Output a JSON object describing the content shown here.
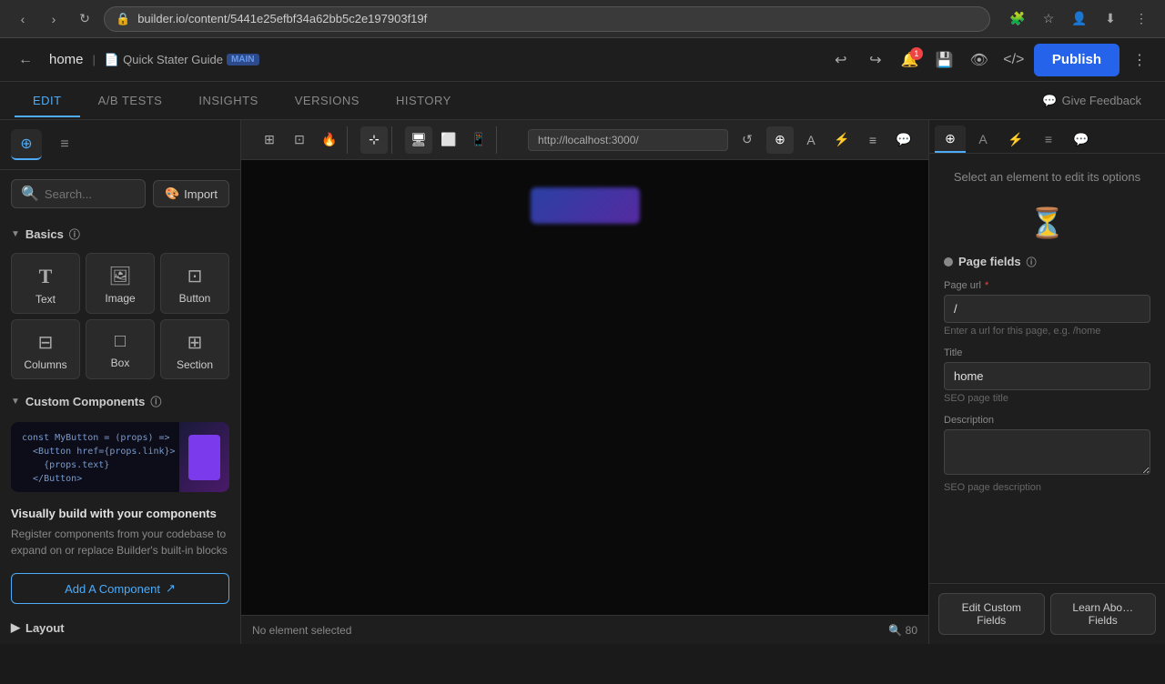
{
  "browser": {
    "url": "builder.io/content/5441e25efbf34a62bb5c2e197903f19f",
    "back_title": "back",
    "forward_title": "forward",
    "refresh_title": "refresh"
  },
  "app_header": {
    "back_label": "←",
    "page_name": "home",
    "breadcrumb_label": "Quick Stater Guide",
    "badge_label": "MAIN",
    "undo_label": "↩",
    "redo_label": "↪",
    "preview_label": "👁",
    "code_label": "</>",
    "bell_label": "🔔",
    "notification_count": "1",
    "publish_label": "Publish",
    "more_label": "⋮"
  },
  "tabs": {
    "items": [
      {
        "id": "edit",
        "label": "EDIT",
        "active": true
      },
      {
        "id": "ab_tests",
        "label": "A/B TESTS",
        "active": false
      },
      {
        "id": "insights",
        "label": "INSIGHTS",
        "active": false
      },
      {
        "id": "versions",
        "label": "VERSIONS",
        "active": false
      },
      {
        "id": "history",
        "label": "HISTORY",
        "active": false
      }
    ],
    "feedback_label": "Give Feedback"
  },
  "toolbar": {
    "layout_btn": "⊞",
    "grid_btn": "⊡",
    "fire_btn": "🔥",
    "select_btn": "⊹",
    "desktop_btn": "🖥",
    "tablet_btn": "⬜",
    "mobile_btn": "📱",
    "url_value": "http://localhost:3000/",
    "refresh_label": "↺",
    "target_btn": "⊕",
    "paint_btn": "🎨",
    "bolt_btn": "⚡",
    "columns_btn": "≡",
    "chat_btn": "💬"
  },
  "left_sidebar": {
    "tab_add": "+",
    "tab_layers": "≡",
    "search_placeholder": "Search...",
    "import_label": "Import",
    "import_icon": "🎨",
    "sections": {
      "basics": {
        "label": "Basics",
        "components": [
          {
            "id": "text",
            "label": "Text",
            "icon": "T"
          },
          {
            "id": "image",
            "label": "Image",
            "icon": "🖼"
          },
          {
            "id": "button",
            "label": "Button",
            "icon": "⊡"
          },
          {
            "id": "columns",
            "label": "Columns",
            "icon": "⊟"
          },
          {
            "id": "box",
            "label": "Box",
            "icon": "□"
          },
          {
            "id": "section",
            "label": "Section",
            "icon": "⊞"
          }
        ]
      },
      "custom": {
        "label": "Custom Components",
        "code_snippet": "const MyButton = (props) =>\n  <Button href={props.link}>\n    {props.text}\n  </Button>",
        "title": "Visually build with your components",
        "description": "Register components from your codebase to expand on or replace Builder's built-in blocks",
        "add_btn": "Add A Component",
        "add_btn_icon": "↗"
      },
      "layout": {
        "label": "Layout"
      }
    }
  },
  "canvas": {
    "status_text": "No element selected",
    "zoom_level": "80"
  },
  "right_panel": {
    "tabs": [
      {
        "id": "select",
        "icon": "⊕",
        "active": true
      },
      {
        "id": "style",
        "icon": "A",
        "active": false
      },
      {
        "id": "bolt",
        "icon": "⚡",
        "active": false
      },
      {
        "id": "columns",
        "icon": "≡",
        "active": false
      },
      {
        "id": "chat",
        "icon": "💬",
        "active": false
      }
    ],
    "select_message": "Select an element to edit its options",
    "page_fields": {
      "header": "Page fields",
      "url_label": "Page url",
      "url_required": "*",
      "url_value": "/",
      "url_hint": "Enter a url for this page, e.g. /home",
      "title_label": "Title",
      "title_value": "home",
      "title_hint": "SEO page title",
      "description_label": "Description",
      "description_value": "",
      "description_hint": "SEO page description"
    },
    "bottom_buttons": [
      {
        "id": "edit_custom",
        "label": "Edit Custom\nFields"
      },
      {
        "id": "learn_about",
        "label": "Learn Abo…\nFields"
      }
    ]
  }
}
